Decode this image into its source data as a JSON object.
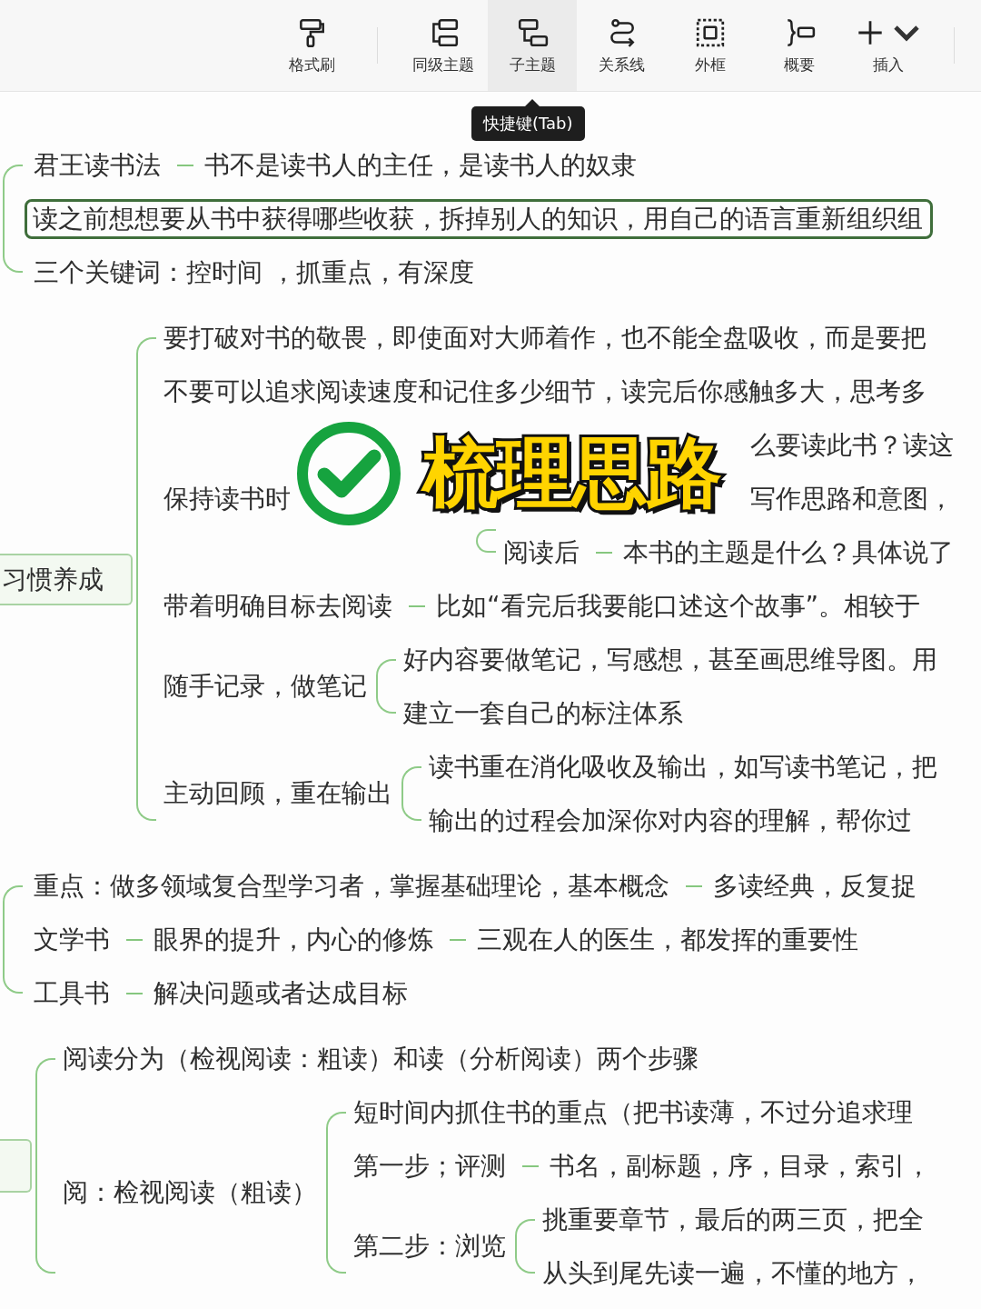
{
  "toolbar": {
    "items": [
      {
        "label": "格式刷",
        "selected": false
      },
      {
        "label": "同级主题",
        "selected": false
      },
      {
        "label": "子主题",
        "selected": true
      },
      {
        "label": "关系线",
        "selected": false
      },
      {
        "label": "外框",
        "selected": false
      },
      {
        "label": "概要",
        "selected": false
      },
      {
        "label": "插入",
        "selected": false
      }
    ]
  },
  "tooltip": {
    "text": "快捷键(Tab)"
  },
  "groups": [
    {
      "root": {
        "kind": "hidden"
      },
      "children": [
        {
          "kind": "topic",
          "chain": [
            "君王读书法",
            "书不是读书人的主任，是读书人的奴隶"
          ],
          "selected": false
        },
        {
          "kind": "topic",
          "chain": [
            "读之前想想要从书中获得哪些收获，拆掉别人的知识，用自己的语言重新组织组"
          ],
          "selected": true
        },
        {
          "kind": "topic",
          "chain": [
            "三个关键词：控时间 ，抓重点，有深度"
          ],
          "selected": false
        }
      ]
    },
    {
      "root": {
        "kind": "boxed",
        "label": "习惯养成"
      },
      "children": [
        {
          "kind": "topic",
          "chain": [
            "要打破对书的敬畏，即使面对大师着作，也不能全盘吸收，而是要把"
          ],
          "selected": false
        },
        {
          "kind": "topic",
          "chain": [
            "不要可以追求阅读速度和记住多少细节，读完后你感触多大，思考多"
          ],
          "selected": false
        },
        {
          "kind": "covered",
          "chain": [
            "保持读书时"
          ],
          "selected": false,
          "children": [
            {
              "kind": "covered",
              "chain": [
                "么要读此书？读这"
              ],
              "selected": false
            },
            {
              "kind": "covered",
              "chain": [
                "写作思路和意图，"
              ],
              "selected": false
            },
            {
              "kind": "topic",
              "chain": [
                "阅读后",
                "本书的主题是什么？具体说了"
              ],
              "selected": false
            }
          ]
        },
        {
          "kind": "topic",
          "chain": [
            "带着明确目标去阅读",
            "比如“看完后我要能口述这个故事”。相较于"
          ],
          "selected": false
        },
        {
          "kind": "topic",
          "chain": [
            "随手记录，做笔记"
          ],
          "selected": false,
          "children": [
            {
              "kind": "topic",
              "chain": [
                "好内容要做笔记，写感想，甚至画思维导图。用"
              ],
              "selected": false
            },
            {
              "kind": "topic",
              "chain": [
                "建立一套自己的标注体系"
              ],
              "selected": false
            }
          ]
        },
        {
          "kind": "topic",
          "chain": [
            "主动回顾，重在输出"
          ],
          "selected": false,
          "children": [
            {
              "kind": "topic",
              "chain": [
                "读书重在消化吸收及输出，如写读书笔记，把"
              ],
              "selected": false
            },
            {
              "kind": "topic",
              "chain": [
                "输出的过程会加深你对内容的理解，帮你过"
              ],
              "selected": false
            }
          ]
        }
      ]
    },
    {
      "root": {
        "kind": "hidden"
      },
      "children": [
        {
          "kind": "topic",
          "chain": [
            "重点：做多领域复合型学习者，掌握基础理论，基本概念",
            "多读经典，反复捉"
          ],
          "selected": false
        },
        {
          "kind": "topic",
          "chain": [
            "文学书",
            "眼界的提升，内心的修炼",
            "三观在人的医生，都发挥的重要性"
          ],
          "selected": false
        },
        {
          "kind": "topic",
          "chain": [
            "工具书",
            "解决问题或者达成目标"
          ],
          "selected": false
        }
      ]
    },
    {
      "root": {
        "kind": "boxed"
      },
      "children": [
        {
          "kind": "topic",
          "chain": [
            "阅读分为（检视阅读：粗读）和读（分析阅读）两个步骤"
          ],
          "selected": false
        },
        {
          "kind": "topic",
          "chain": [
            "阅：检视阅读（粗读）"
          ],
          "selected": false,
          "children": [
            {
              "kind": "topic",
              "chain": [
                "短时间内抓住书的重点（把书读薄，不过分追求理"
              ],
              "selected": false
            },
            {
              "kind": "topic",
              "chain": [
                "第一步；评测",
                "书名，副标题，序，目录，索引，"
              ],
              "selected": false
            },
            {
              "kind": "topic",
              "chain": [
                "第二步：浏览"
              ],
              "selected": false,
              "children": [
                {
                  "kind": "topic",
                  "chain": [
                    "挑重要章节，最后的两三页，把全"
                  ],
                  "selected": false
                },
                {
                  "kind": "topic",
                  "chain": [
                    "从头到尾先读一遍，不懂的地方，"
                  ],
                  "selected": false
                }
              ]
            }
          ]
        }
      ]
    }
  ],
  "sticker": {
    "text": "梳理思路"
  }
}
